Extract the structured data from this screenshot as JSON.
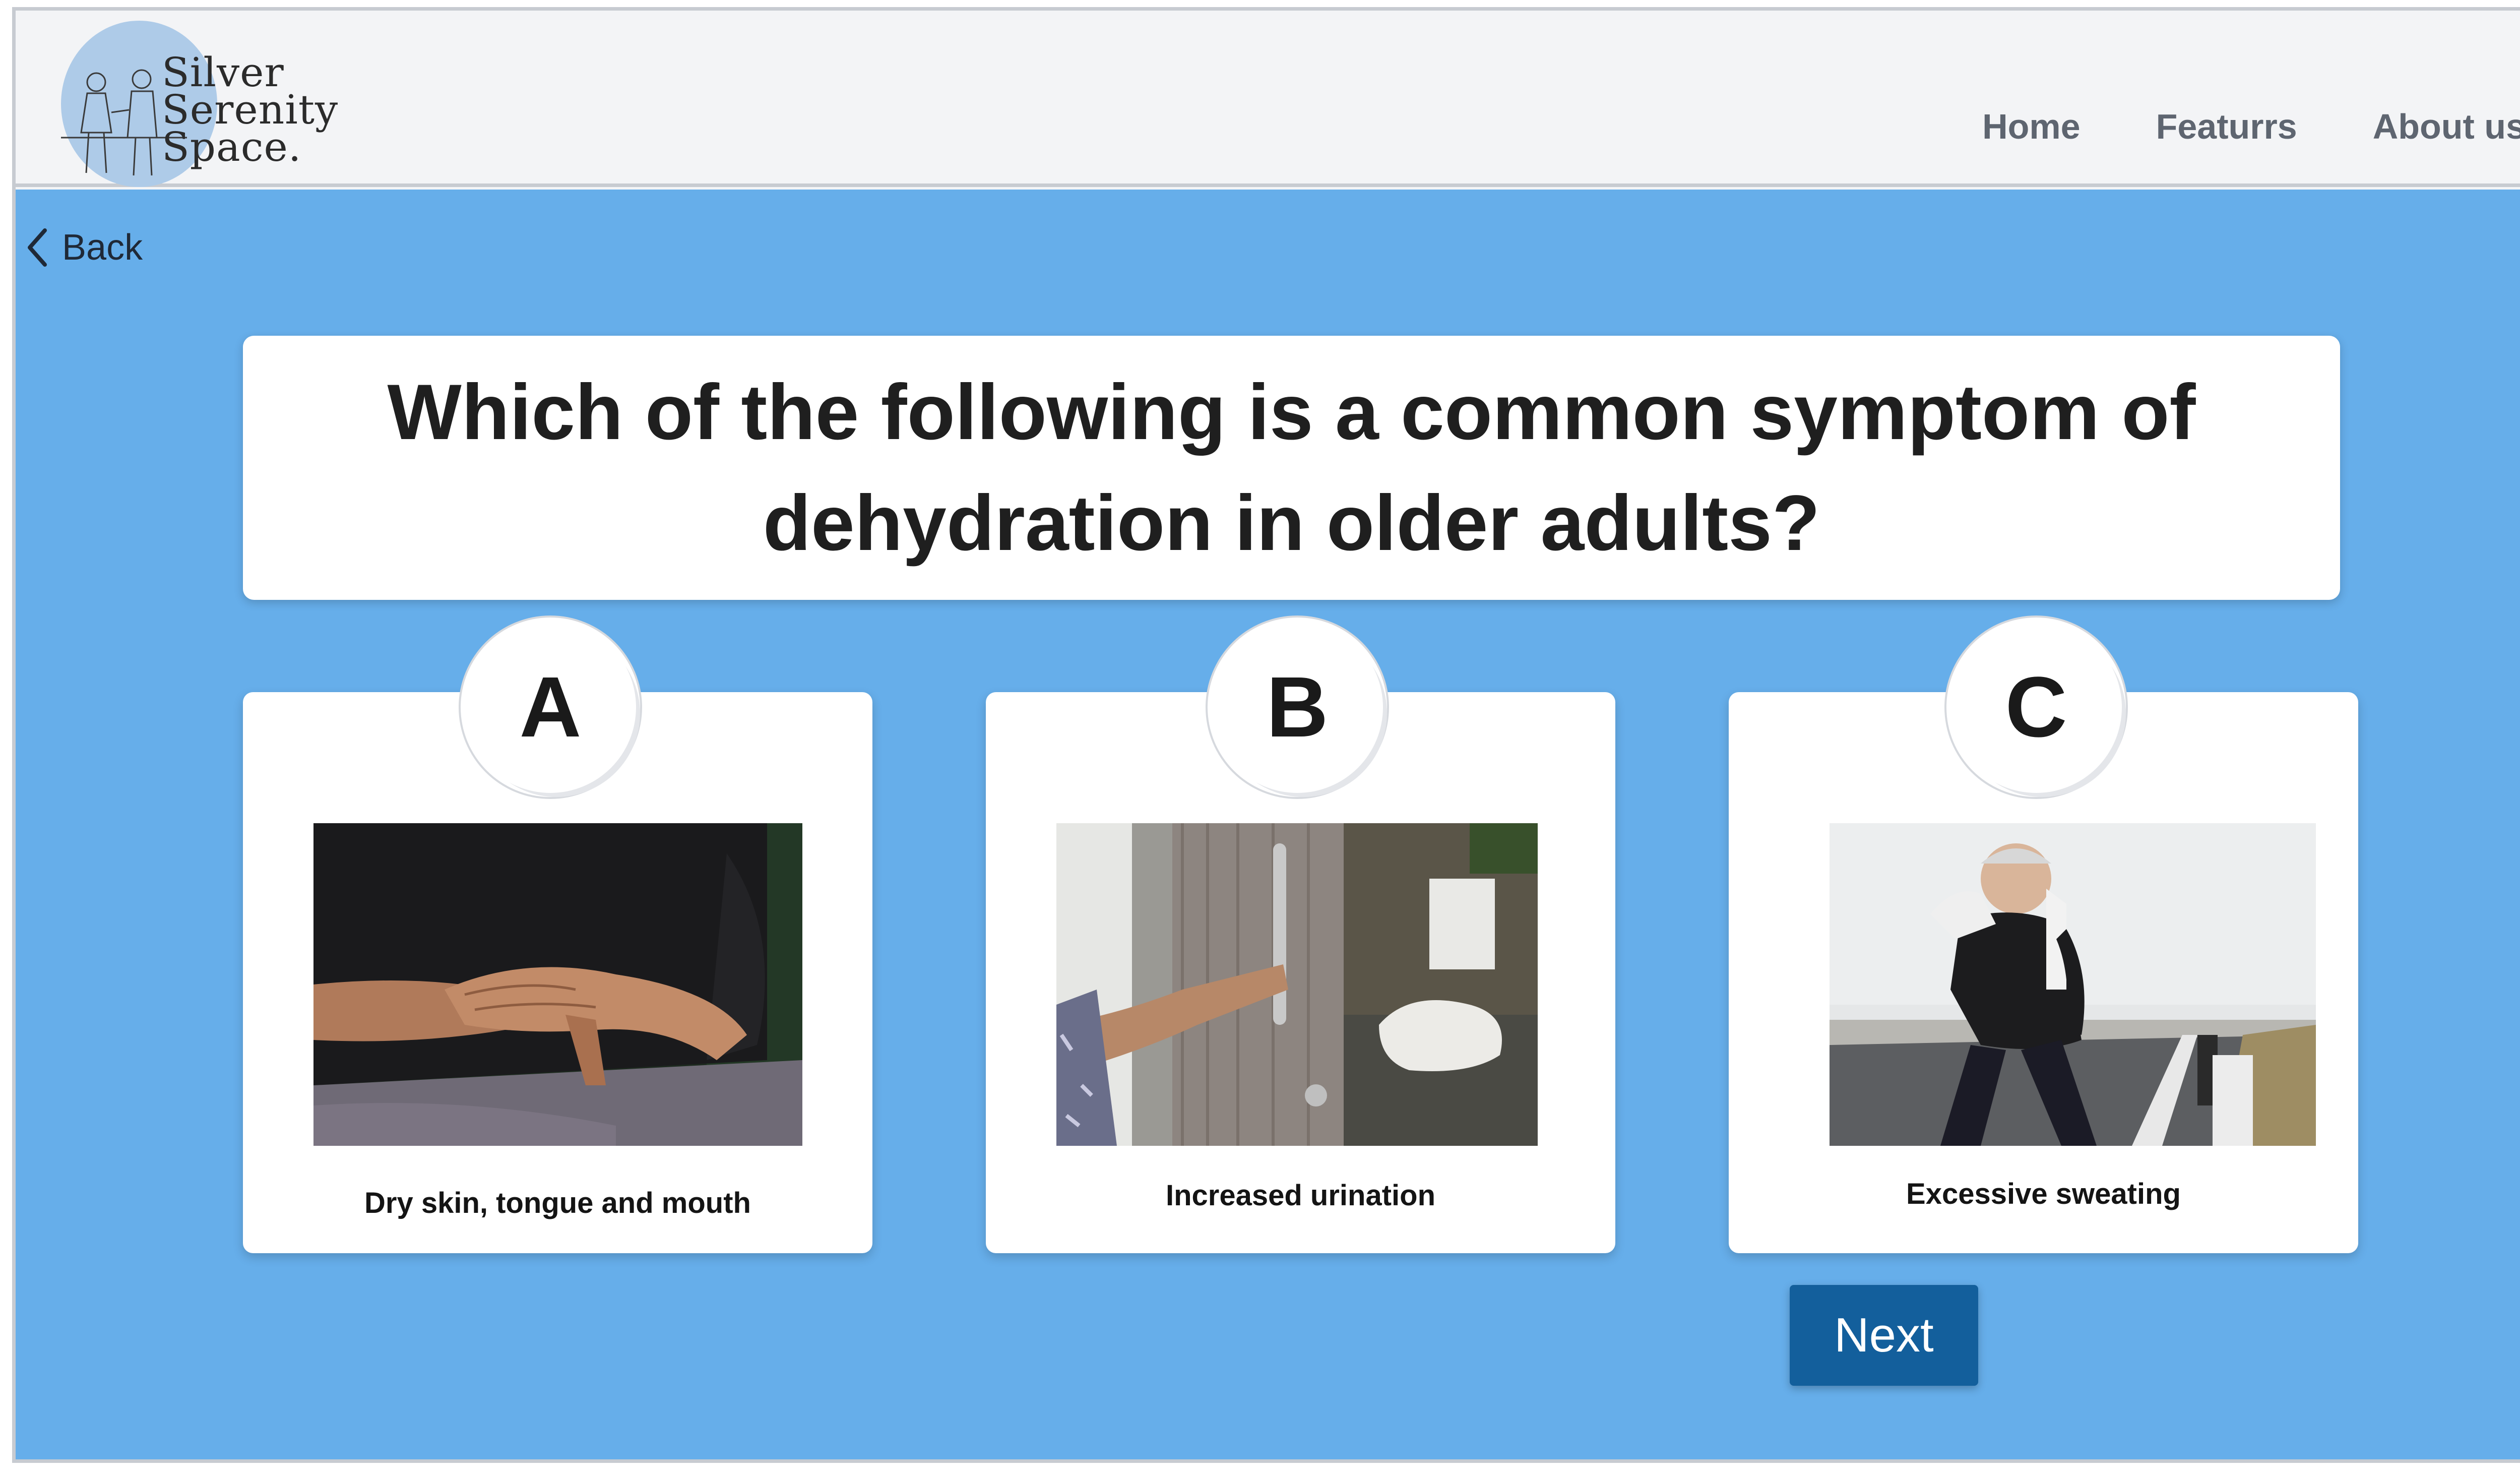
{
  "brand": {
    "logo_lines": [
      "Silver",
      "Serenity",
      "Space."
    ],
    "blob_color": "#aecbe8"
  },
  "nav": {
    "items": [
      {
        "label": "Home"
      },
      {
        "label": "Featurrs"
      },
      {
        "label": "About us"
      }
    ]
  },
  "back": {
    "label": "Back",
    "icon": "chevron-left-icon"
  },
  "quiz": {
    "question": "Which of the following is a common symptom of dehydration in older adults?",
    "options": [
      {
        "letter": "A",
        "caption": "Dry skin, tongue and mouth",
        "image": "hands-dry-skin-photo"
      },
      {
        "letter": "B",
        "caption": "Increased urination",
        "image": "bathroom-door-photo"
      },
      {
        "letter": "C",
        "caption": "Excessive sweating",
        "image": "man-sweating-photo"
      }
    ],
    "next_label": "Next"
  },
  "colors": {
    "background": "#66aeea",
    "next_button": "#135f9c",
    "card": "#ffffff",
    "header": "#f3f4f6"
  }
}
